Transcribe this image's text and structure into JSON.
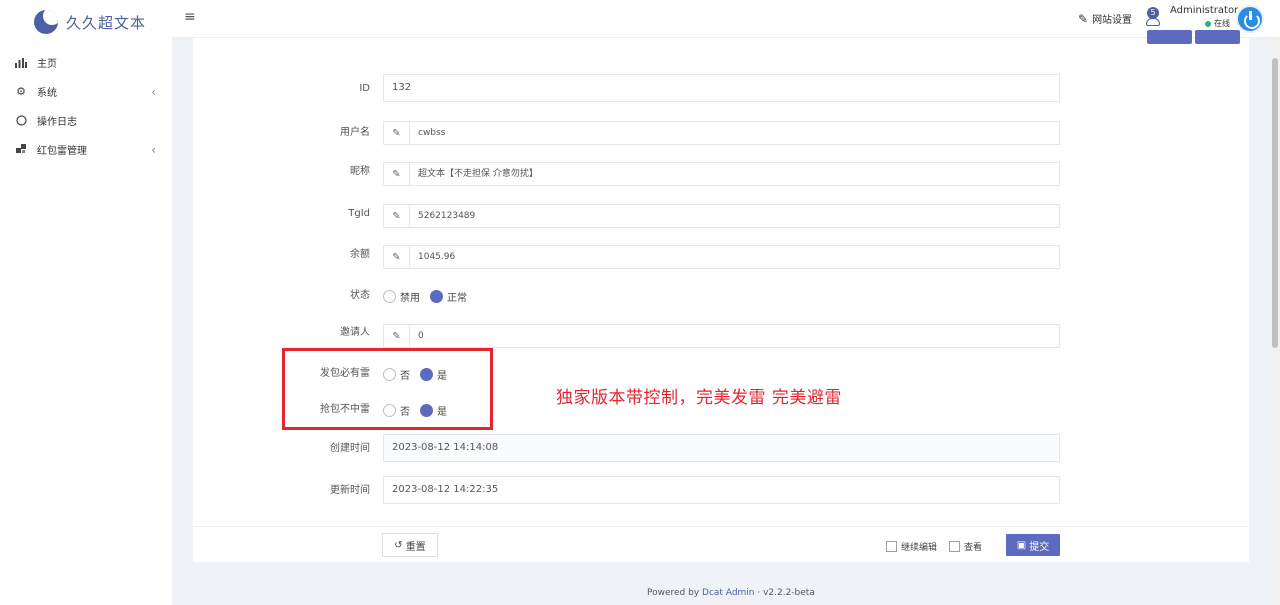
{
  "brand": {
    "name": "久久超文本"
  },
  "sidebar": {
    "items": [
      {
        "icon": "bar-chart-icon",
        "label": "主页",
        "chevron": ""
      },
      {
        "icon": "gear-icon",
        "label": "系统",
        "chevron": "‹"
      },
      {
        "icon": "circle-icon",
        "label": "操作日志",
        "chevron": ""
      },
      {
        "icon": "puzzle-icon",
        "label": "红包雷管理",
        "chevron": "‹"
      }
    ]
  },
  "header": {
    "menu_toggle": "≡",
    "site_settings": "网站设置",
    "notifications": "5",
    "user_name": "Administrator",
    "user_status": "在线"
  },
  "form": {
    "id": {
      "label": "ID",
      "value": "132"
    },
    "username": {
      "label": "用户名",
      "value": "cwbss"
    },
    "nickname": {
      "label": "昵称",
      "value": "超文本【不走担保 介意勿扰】"
    },
    "tgid": {
      "label": "TgId",
      "value": "5262123489"
    },
    "balance": {
      "label": "余额",
      "value": "1045.96"
    },
    "status": {
      "label": "状态",
      "options": [
        "禁用",
        "正常"
      ],
      "selected": "正常"
    },
    "inviter": {
      "label": "邀请人",
      "value": "0"
    },
    "must_mine": {
      "label": "发包必有雷",
      "options": [
        "否",
        "是"
      ],
      "selected": "是"
    },
    "grab_no_mine": {
      "label": "抢包不中雷",
      "options": [
        "否",
        "是"
      ],
      "selected": "是"
    },
    "created_at": {
      "label": "创建时间",
      "value": "2023-08-12 14:14:08"
    },
    "updated_at": {
      "label": "更新时间",
      "value": "2023-08-12 14:22:35"
    }
  },
  "annotation": "独家版本带控制，完美发雷  完美避雷",
  "footer": {
    "reset": "重置",
    "continue_edit": "继续编辑",
    "view": "查看",
    "submit": "提交"
  },
  "credit": {
    "prefix": "Powered by ",
    "link": "Dcat Admin",
    "version": " · v2.2.2-beta"
  }
}
